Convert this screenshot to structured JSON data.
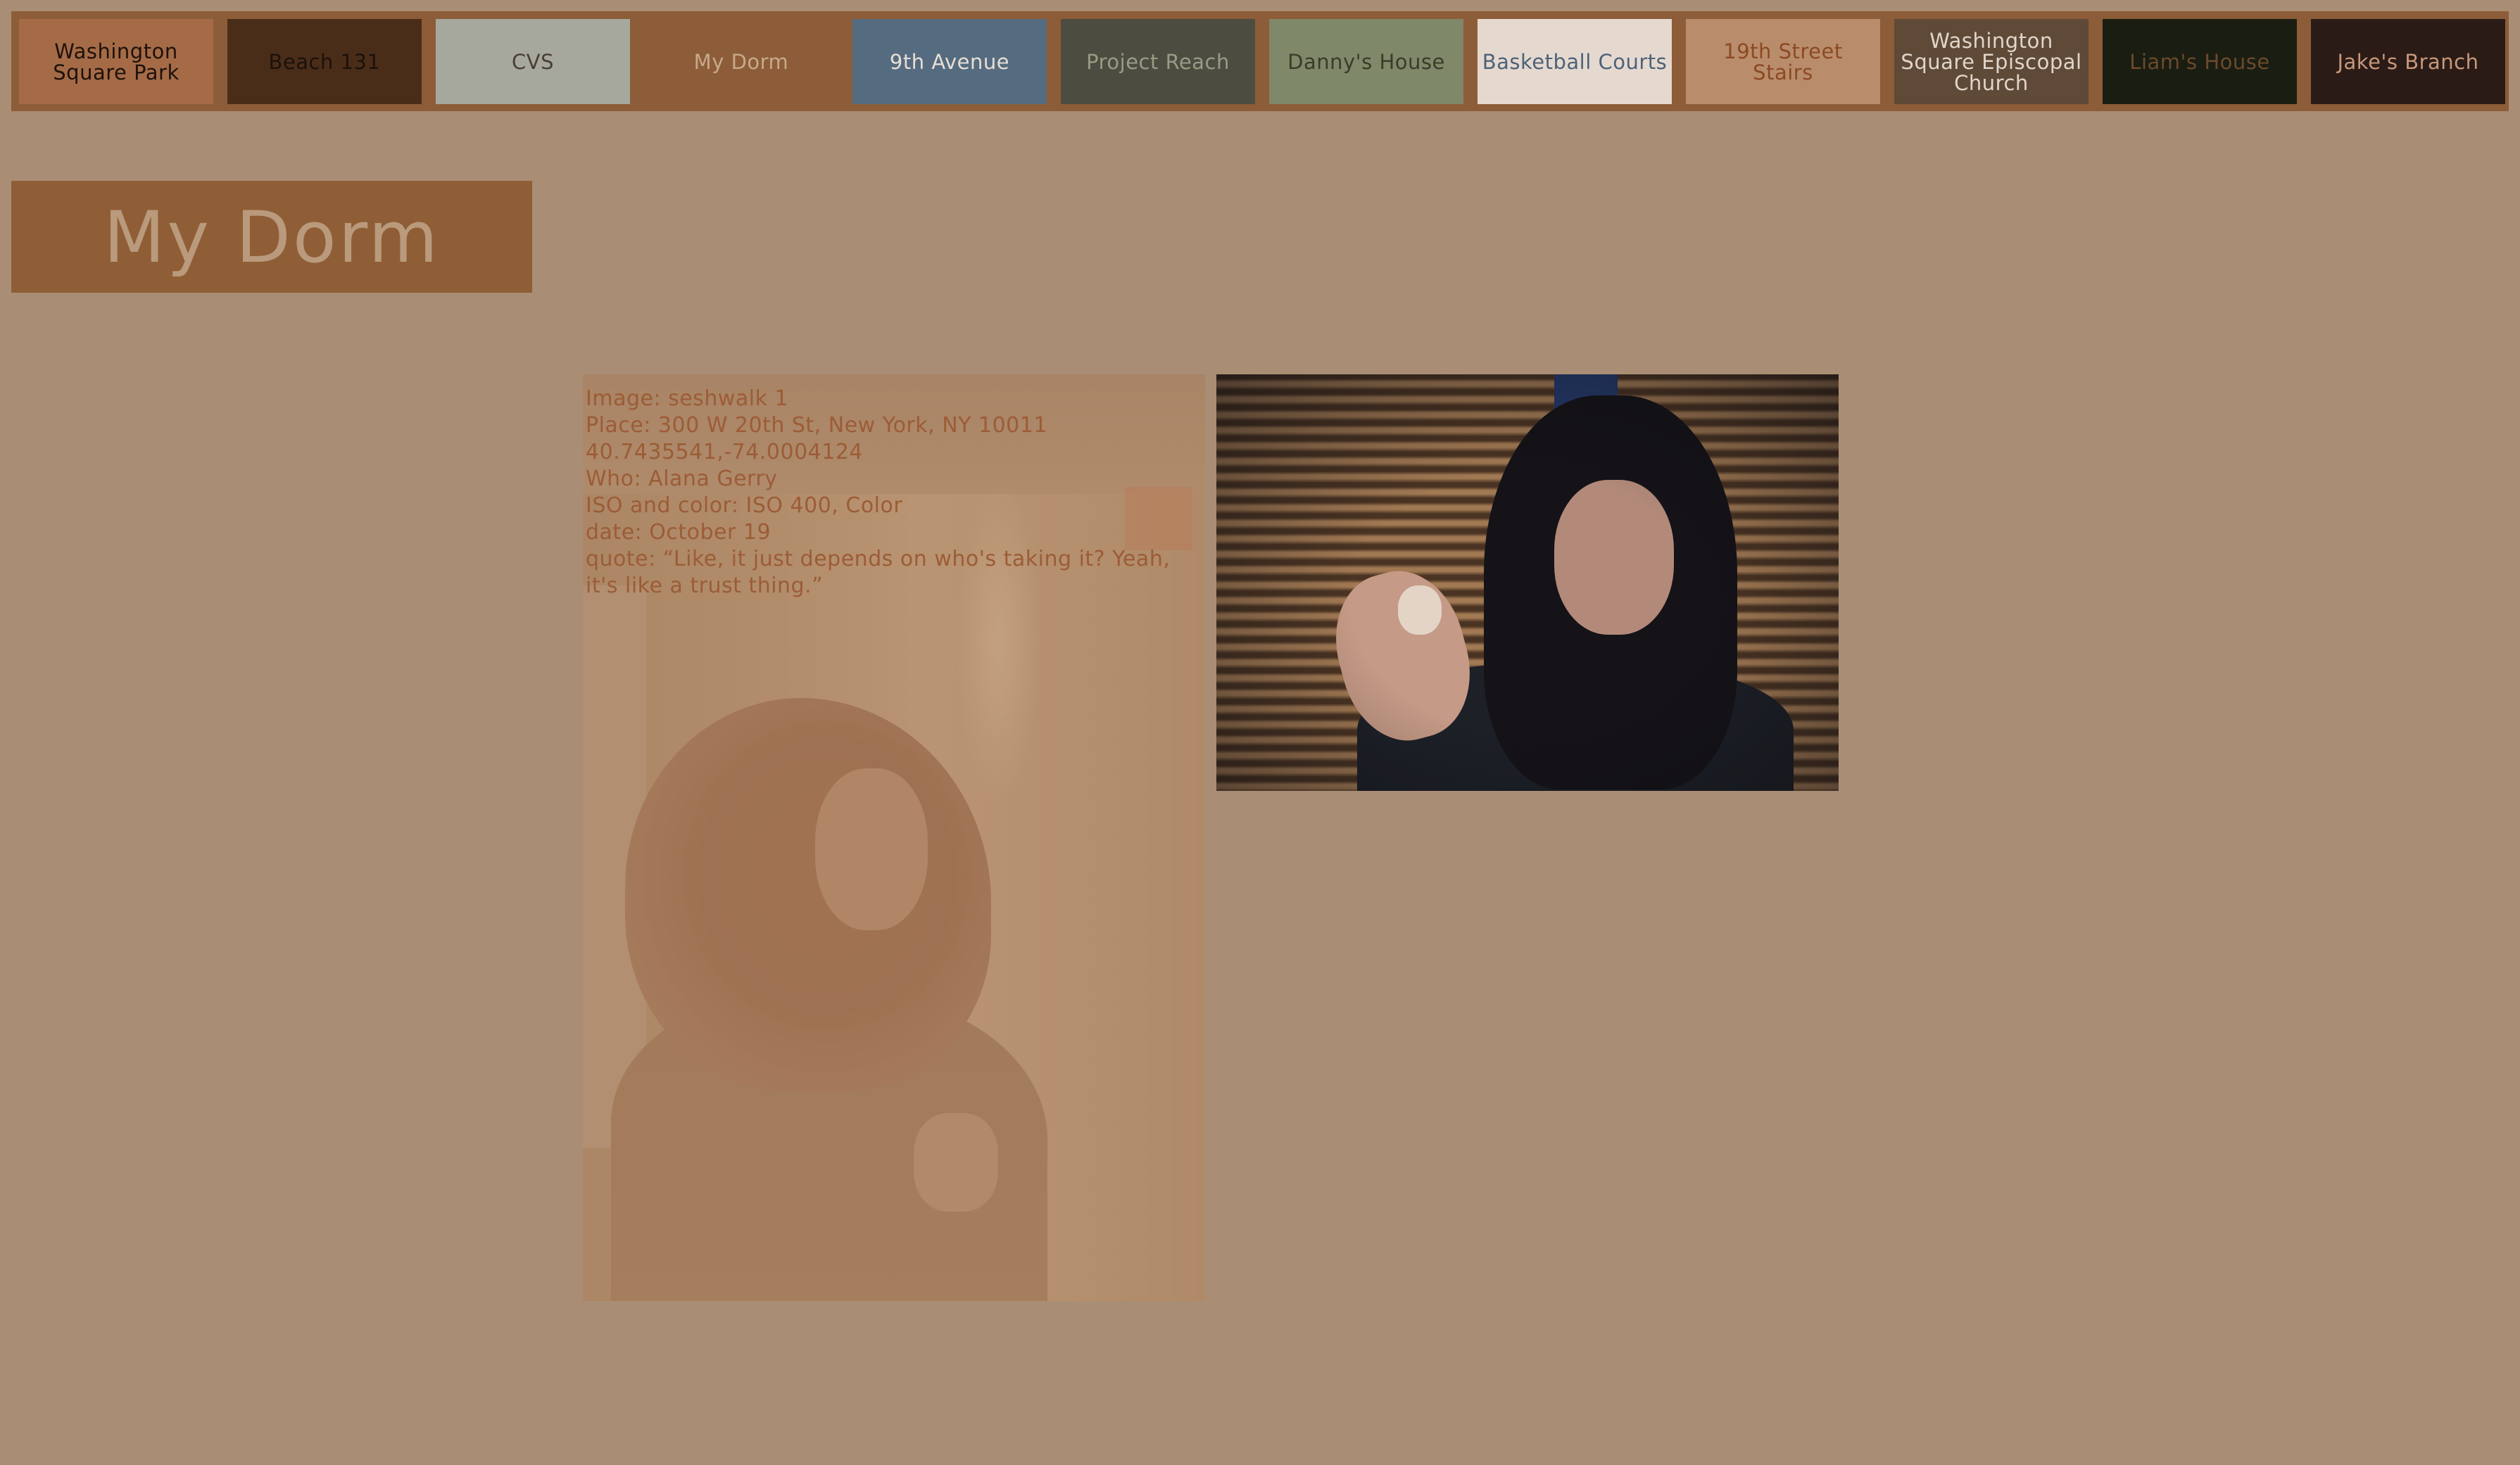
{
  "nav": {
    "items": [
      {
        "label_lines": [
          "Washington",
          "Square Park"
        ],
        "bg": "#a56b47",
        "fg": "#1e120a"
      },
      {
        "label_lines": [
          "Beach 131"
        ],
        "bg": "#4a2d19",
        "fg": "#1c110a"
      },
      {
        "label_lines": [
          "CVS"
        ],
        "bg": "#a6a89e",
        "fg": "#4a3f34"
      },
      {
        "label_lines": [
          "My Dorm"
        ],
        "bg": "#8c5d38",
        "fg": "#c7a98c"
      },
      {
        "label_lines": [
          "9th Avenue"
        ],
        "bg": "#556b80",
        "fg": "#e6ded4"
      },
      {
        "label_lines": [
          "Project Reach"
        ],
        "bg": "#4d4c40",
        "fg": "#9b9a85"
      },
      {
        "label_lines": [
          "Danny's House"
        ],
        "bg": "#7f8868",
        "fg": "#3b3b2c"
      },
      {
        "label_lines": [
          "Basketball Courts"
        ],
        "bg": "#e5d9cf",
        "fg": "#4e6278"
      },
      {
        "label_lines": [
          "19th Street",
          "Stairs"
        ],
        "bg": "#b98c6c",
        "fg": "#8c4a22"
      },
      {
        "label_lines": [
          "Washington",
          "Square Episcopal",
          "Church"
        ],
        "bg": "#5f4937",
        "fg": "#e0d5c9"
      },
      {
        "label_lines": [
          "Liam's House"
        ],
        "bg": "#1a1d12",
        "fg": "#6b4a2a"
      },
      {
        "label_lines": [
          "Jake's Branch"
        ],
        "bg": "#2a1b17",
        "fg": "#c8977a"
      }
    ]
  },
  "page": {
    "title": "My Dorm"
  },
  "caption": {
    "lines": [
      "Image: seshwalk 1",
      "Place: 300 W 20th St, New York, NY 10011",
      "40.7435541,-74.0004124",
      "Who: Alana Gerry",
      "ISO and color: ISO 400, Color",
      "date: October 19",
      "quote: “Like, it just depends on who's taking it? Yeah, it's like a trust thing.”"
    ]
  },
  "colors": {
    "page_bg": "#a98e75",
    "nav_bar": "#8c5d38",
    "title_box": "#8f5e36",
    "title_text": "#b99a7c",
    "caption_text": "#9c5c36"
  }
}
